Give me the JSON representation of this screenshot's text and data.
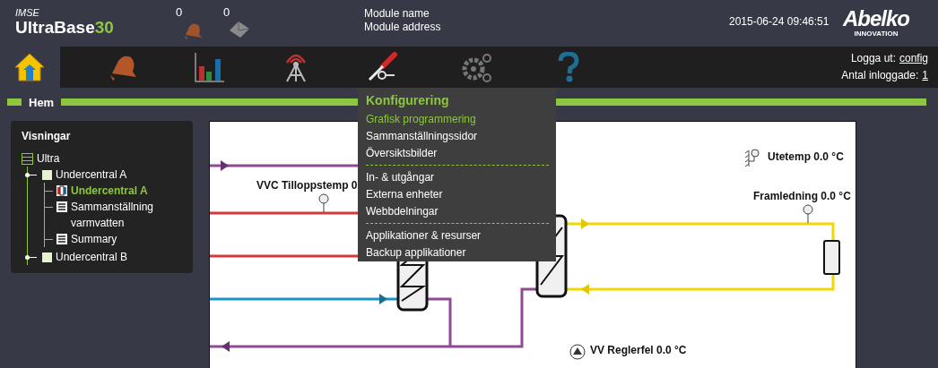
{
  "header": {
    "brand_small": "IMSE",
    "brand": "UltraBase",
    "brand_number": "30",
    "alarms_count": "0",
    "messages_count": "0",
    "module_name": "Module name",
    "module_address": "Module address",
    "datetime": "2015-06-24 09:46:51",
    "logo": "Abelko",
    "logo_sub": "INNOVATION"
  },
  "nav": {
    "items": [
      {
        "kind": "home",
        "selected": true
      },
      {
        "kind": "alarm",
        "selected": false
      },
      {
        "kind": "chart",
        "selected": false
      },
      {
        "kind": "antenna",
        "selected": false
      },
      {
        "kind": "tools",
        "selected": false
      },
      {
        "kind": "gears",
        "selected": false
      },
      {
        "kind": "help",
        "selected": false
      }
    ],
    "session": {
      "logout_label": "Logga ut:",
      "user": "config",
      "logged_in_label": "Antal inloggade:",
      "logged_in_count": "1"
    }
  },
  "page_title": "Hem",
  "dropdown": {
    "title": "Konfigurering",
    "sections": [
      [
        {
          "label": "Grafisk programmering",
          "selected": true
        },
        {
          "label": "Sammanställningssidor",
          "selected": false
        },
        {
          "label": "Översiktsbilder",
          "selected": false
        }
      ],
      [
        {
          "label": "In- & utgångar",
          "selected": false
        },
        {
          "label": "Externa enheter",
          "selected": false
        },
        {
          "label": "Webbdelningar",
          "selected": false
        }
      ],
      [
        {
          "label": "Applikationer & resurser",
          "selected": false
        },
        {
          "label": "Backup applikationer",
          "selected": false
        }
      ]
    ]
  },
  "sidebar": {
    "title": "Visningar",
    "tree": [
      {
        "label": "Ultra",
        "kind": "root",
        "selected": false,
        "children": [
          {
            "label": "Undercentral A",
            "kind": "folder",
            "selected": false,
            "children": [
              {
                "label": "Undercentral A",
                "kind": "diagram",
                "selected": true
              },
              {
                "label": "Sammanställning varmvatten",
                "kind": "list",
                "selected": false
              },
              {
                "label": "Summary",
                "kind": "list",
                "selected": false
              }
            ]
          },
          {
            "label": "Undercentral B",
            "kind": "folder",
            "selected": false
          }
        ]
      }
    ]
  },
  "diagram": {
    "labels": [
      {
        "kind": "sensor",
        "text": "VVC Tilloppstemp 0"
      },
      {
        "kind": "outdoor",
        "text": "Utetemp 0.0 °C"
      },
      {
        "kind": "sensor",
        "text": "Framledning 0.0 °C"
      },
      {
        "kind": "alarm",
        "text": "VV Reglerfel 0.0 °C"
      }
    ]
  }
}
